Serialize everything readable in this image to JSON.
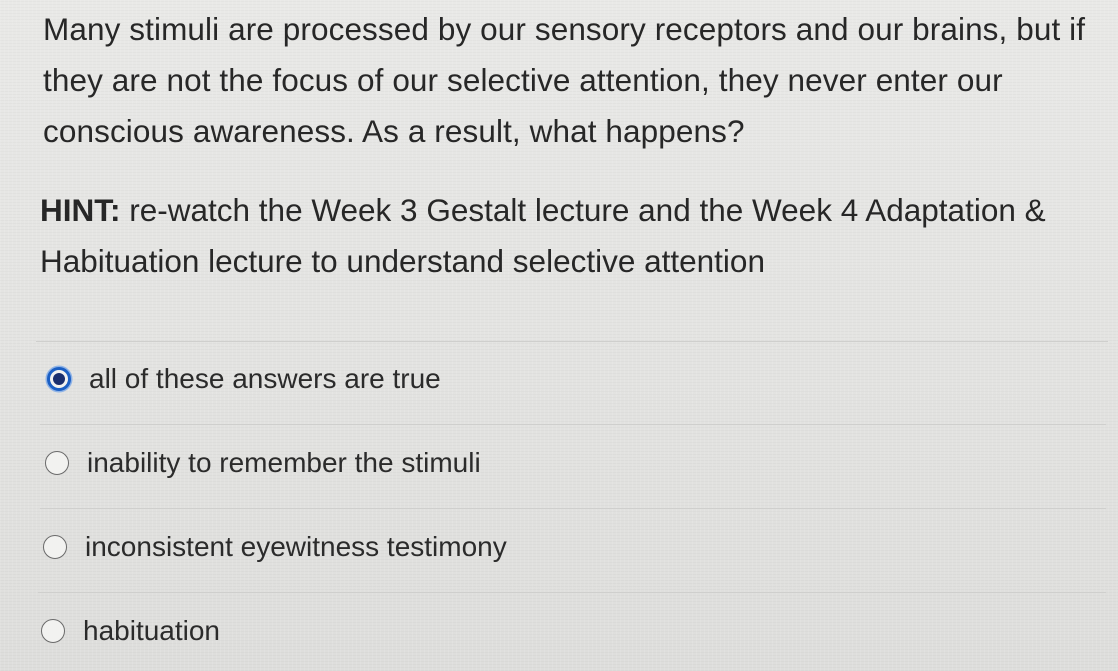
{
  "question": {
    "text": "Many stimuli are processed by our sensory receptors and our brains, but if they are not the focus of our selective attention, they never enter our conscious awareness. As a result, what happens?",
    "hint_label": "HINT:",
    "hint_text": "re-watch the Week 3 Gestalt lecture and the Week 4 Adaptation & Habituation lecture to understand selective attention"
  },
  "answers": [
    {
      "label": "all of these answers are true",
      "selected": true
    },
    {
      "label": "inability to remember the stimuli",
      "selected": false
    },
    {
      "label": "inconsistent eyewitness testimony",
      "selected": false
    },
    {
      "label": "habituation",
      "selected": false
    }
  ],
  "colors": {
    "radio_selected": "#1b5fc4",
    "text": "#272727"
  }
}
